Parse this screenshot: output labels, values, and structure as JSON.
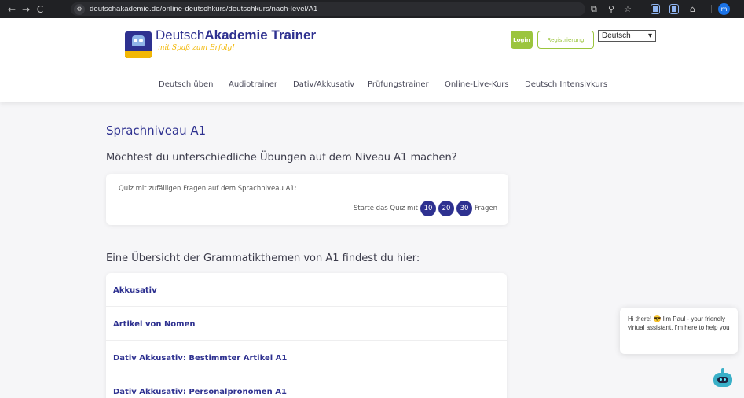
{
  "browser": {
    "back": "←",
    "forward": "→",
    "reload": "C",
    "url": "deutschakademie.de/online-deutschkurs/deutschkurs/nach-level/A1",
    "profile_initial": "m"
  },
  "header": {
    "brand_part1": "Deutsch",
    "brand_part2": "Akademie Trainer",
    "tagline": "mit Spaß zum Erfolg!",
    "login": "Login",
    "register": "Registrierung",
    "language": "Deutsch",
    "language_arrow": "▾",
    "menu": [
      "Deutsch üben",
      "Audiotrainer",
      "Dativ/Akkusativ",
      "Prüfungstrainer",
      "Online-Live-Kurs",
      "Deutsch Intensivkurs"
    ]
  },
  "main": {
    "title": "Sprachniveau A1",
    "subhead": "Möchtest du unterschiedliche Übungen auf dem Niveau A1 machen?",
    "quiz": {
      "label": "Quiz mit zufälligen Fragen auf dem Sprachniveau A1:",
      "prefix": "Starte das Quiz mit",
      "options": [
        "10",
        "20",
        "30"
      ],
      "suffix": "Fragen"
    },
    "grammar_head": "Eine Übersicht der Grammatikthemen von A1 findest du hier:",
    "topics": [
      "Akkusativ",
      "Artikel von Nomen",
      "Dativ Akkusativ: Bestimmter Artikel A1",
      "Dativ Akkusativ: Personalpronomen A1"
    ]
  },
  "chat": {
    "message": "Hi there! 😎 I'm Paul - your friendly virtual assistant. I'm here to help you"
  },
  "colors": {
    "brand": "#2e3190",
    "accent": "#9bc53d",
    "tagline": "#f2b705"
  }
}
